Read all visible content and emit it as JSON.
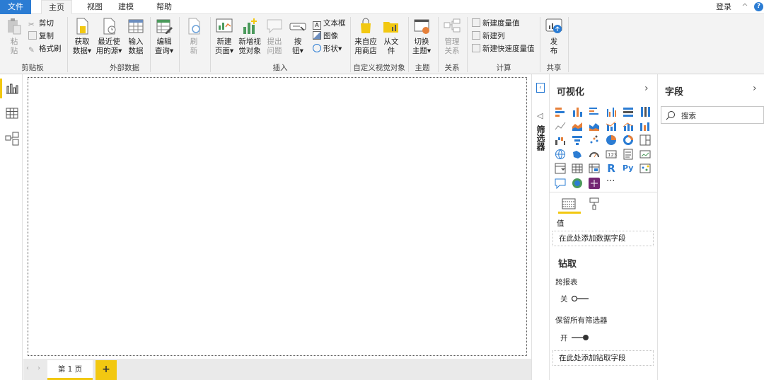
{
  "menubar": {
    "tabs": [
      {
        "label": "文件"
      },
      {
        "label": "主页"
      },
      {
        "label": "视图"
      },
      {
        "label": "建模"
      },
      {
        "label": "帮助"
      }
    ],
    "login": "登录",
    "help": "?"
  },
  "ribbon": {
    "clipboard": {
      "paste": "粘\n贴",
      "cut": "剪切",
      "copy": "复制",
      "format_painter": "格式刷",
      "group": "剪贴板"
    },
    "external": {
      "get_data": "获取\n数据▾",
      "recent": "最近使\n用的源▾",
      "enter": "输入\n数据",
      "edit_query": "编辑\n查询▾",
      "group": "外部数据"
    },
    "refresh": "刷\n新",
    "insert": {
      "new_page": "新建\n页面▾",
      "new_visual": "新增视\n觉对象",
      "ask": "提出\n问题",
      "buttons": "按\n钮▾",
      "textbox": "文本框",
      "image": "图像",
      "shapes": "形状▾",
      "group": "插入"
    },
    "custom": {
      "marketplace": "来自应\n用商店",
      "from_file": "从文\n件",
      "group": "自定义视觉对象"
    },
    "theme": {
      "switch": "切换\n主题▾",
      "group": "主题"
    },
    "relation": {
      "manage": "管理\n关系",
      "group": "关系"
    },
    "calc": {
      "new_measure": "新建度量值",
      "new_column": "新建列",
      "new_quick": "新建快速度量值",
      "group": "计算"
    },
    "share": {
      "publish": "发\n布",
      "group": "共享"
    }
  },
  "pages": {
    "tab": "第 1 页",
    "add": "+"
  },
  "filters": {
    "label": "筛选器"
  },
  "visualizations": {
    "title": "可视化",
    "more": "···",
    "values_label": "值",
    "values_drop": "在此处添加数据字段",
    "drill_title": "钻取",
    "cross_report": "跨报表",
    "cross_state": "关",
    "keep_filters": "保留所有筛选器",
    "keep_state": "开",
    "drill_drop": "在此处添加钻取字段"
  },
  "fields": {
    "title": "字段",
    "search_placeholder": "搜索"
  },
  "colors": {
    "accent": "#2b7cd3",
    "yellow": "#f2c811",
    "orange": "#e6803a"
  }
}
